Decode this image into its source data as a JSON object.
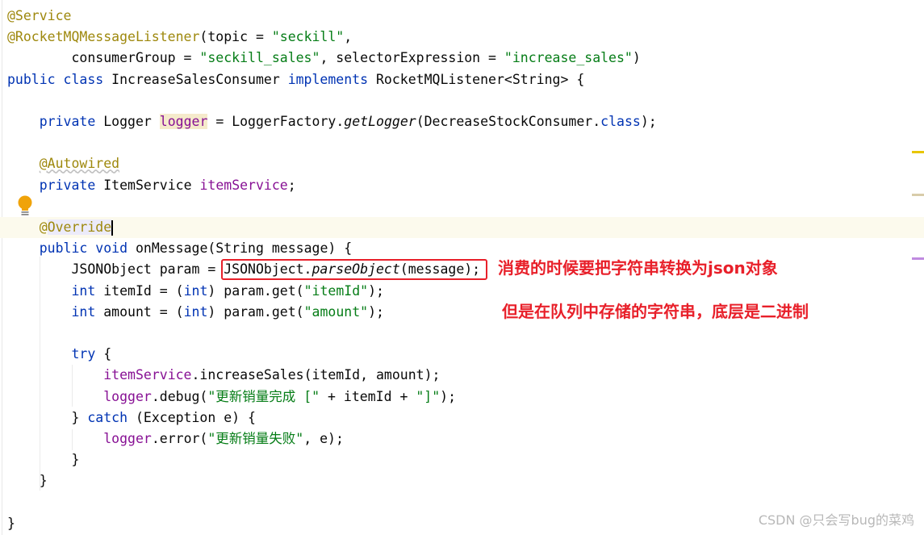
{
  "editor": {
    "current_line": 11,
    "lines": [
      [
        {
          "t": "@Service",
          "c": "ann"
        }
      ],
      [
        {
          "t": "@RocketMQMessageListener",
          "c": "ann"
        },
        {
          "t": "(topic = "
        },
        {
          "t": "\"seckill\"",
          "c": "str"
        },
        {
          "t": ","
        }
      ],
      [
        {
          "t": "        consumerGroup = "
        },
        {
          "t": "\"seckill_sales\"",
          "c": "str"
        },
        {
          "t": ", selectorExpression = "
        },
        {
          "t": "\"increase_sales\"",
          "c": "str"
        },
        {
          "t": ")"
        }
      ],
      [
        {
          "t": "public class ",
          "c": "kw"
        },
        {
          "t": "IncreaseSalesConsumer "
        },
        {
          "t": "implements ",
          "c": "kw"
        },
        {
          "t": "RocketMQListener<String> {"
        }
      ],
      [],
      [
        {
          "t": "    "
        },
        {
          "t": "private ",
          "c": "kw"
        },
        {
          "t": "Logger "
        },
        {
          "t": "logger",
          "c": "fld hl"
        },
        {
          "t": " = LoggerFactory."
        },
        {
          "t": "getLogger",
          "c": "it"
        },
        {
          "t": "(DecreaseStockConsumer."
        },
        {
          "t": "class",
          "c": "kw"
        },
        {
          "t": ");"
        }
      ],
      [],
      [
        {
          "t": "    "
        },
        {
          "t": "@Autowired",
          "c": "ann wavy"
        }
      ],
      [
        {
          "t": "    "
        },
        {
          "t": "private ",
          "c": "kw"
        },
        {
          "t": "ItemService "
        },
        {
          "t": "itemService",
          "c": "fld"
        },
        {
          "t": ";"
        }
      ],
      [],
      [
        {
          "t": "    "
        },
        {
          "t": "@",
          "c": "ann"
        },
        {
          "t": "Override",
          "c": "ann hl2"
        },
        {
          "t": "",
          "c": "caret"
        }
      ],
      [
        {
          "t": "    "
        },
        {
          "t": "public void ",
          "c": "kw"
        },
        {
          "t": "onMessage(String message) {"
        }
      ],
      [
        {
          "t": "        JSONObject param = JSONObject."
        },
        {
          "t": "parseObject",
          "c": "it"
        },
        {
          "t": "(message);"
        }
      ],
      [
        {
          "t": "        "
        },
        {
          "t": "int ",
          "c": "kw"
        },
        {
          "t": "itemId = ("
        },
        {
          "t": "int",
          "c": "kw"
        },
        {
          "t": ") param.get("
        },
        {
          "t": "\"itemId\"",
          "c": "str"
        },
        {
          "t": ");"
        }
      ],
      [
        {
          "t": "        "
        },
        {
          "t": "int ",
          "c": "kw"
        },
        {
          "t": "amount = ("
        },
        {
          "t": "int",
          "c": "kw"
        },
        {
          "t": ") param.get("
        },
        {
          "t": "\"amount\"",
          "c": "str"
        },
        {
          "t": ");"
        }
      ],
      [],
      [
        {
          "t": "        "
        },
        {
          "t": "try ",
          "c": "kw"
        },
        {
          "t": "{"
        }
      ],
      [
        {
          "t": "            "
        },
        {
          "t": "itemService",
          "c": "fld"
        },
        {
          "t": ".increaseSales(itemId, amount);"
        }
      ],
      [
        {
          "t": "            "
        },
        {
          "t": "logger",
          "c": "fld"
        },
        {
          "t": ".debug("
        },
        {
          "t": "\"更新销量完成 [\"",
          "c": "str"
        },
        {
          "t": " + itemId + "
        },
        {
          "t": "\"]\"",
          "c": "str"
        },
        {
          "t": ");"
        }
      ],
      [
        {
          "t": "        } "
        },
        {
          "t": "catch ",
          "c": "kw"
        },
        {
          "t": "(Exception e) {"
        }
      ],
      [
        {
          "t": "            "
        },
        {
          "t": "logger",
          "c": "fld"
        },
        {
          "t": ".error("
        },
        {
          "t": "\"更新销量失败\"",
          "c": "str"
        },
        {
          "t": ", e);"
        }
      ],
      [
        {
          "t": "        }"
        }
      ],
      [
        {
          "t": "    }"
        }
      ],
      [],
      [
        {
          "t": "}"
        }
      ]
    ]
  },
  "annotations": {
    "note1": "消费的时候要把字符串转换为json对象",
    "note2": "但是在队列中存储的字符串，底层是二进制",
    "color": "#e8202a"
  },
  "scrollbar_markers": [
    "#e8c600",
    "#d8ccaa",
    "#c08ae0"
  ],
  "watermark": "CSDN @只会写bug的菜鸡"
}
